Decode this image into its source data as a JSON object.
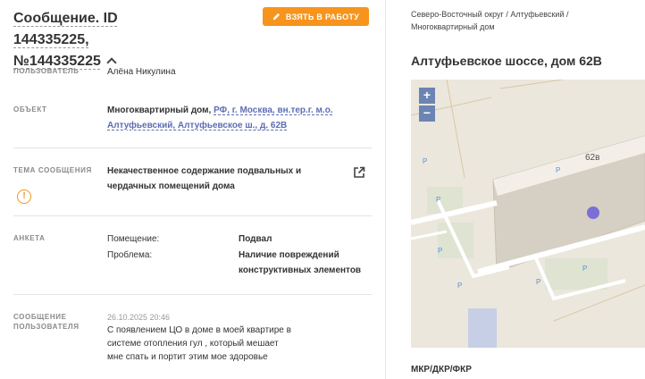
{
  "header": {
    "title_line1": "Сообщение. ID 144335225,",
    "title_line2": "№144335225",
    "take_button": "ВЗЯТЬ В РАБОТУ"
  },
  "user": {
    "label": "ПОЛЬЗОВАТЕЛЬ",
    "value": "Алёна Никулина"
  },
  "object": {
    "label": "ОБЪЕКТ",
    "type": "Многоквартирный дом,",
    "address_line1": "РФ, г. Москва, вн.тер.г. м.о.",
    "address_line2": "Алтуфьевский, Алтуфьевское ш., д. 62В"
  },
  "topic": {
    "label": "ТЕМА СООБЩЕНИЯ",
    "value_line1": "Некачественное содержание подвальных и",
    "value_line2": "чердачных помещений дома",
    "warn_symbol": "!"
  },
  "form": {
    "label": "АНКЕТА",
    "room_label": "Помещение:",
    "room_value": "Подвал",
    "problem_label": "Проблема:",
    "problem_value_line1": "Наличие повреждений",
    "problem_value_line2": "конструктивных элементов"
  },
  "message": {
    "label_line1": "СООБЩЕНИЕ",
    "label_line2": "ПОЛЬЗОВАТЕЛЯ",
    "date": "26.10.2025 20:46",
    "text_line1": "С появлением ЦО в доме в моей квартире в",
    "text_line2": "системе отопления гул , который мешает",
    "text_line3": "мне спать и портит этим мое здоровье"
  },
  "right": {
    "breadcrumb_line1": "Северо-Восточный округ / Алтуфьевский /",
    "breadcrumb_line2": "Многоквартирный дом",
    "address": "Алтуфьевское шоссе, дом 62В",
    "map_building_label": "62в",
    "zoom_in": "+",
    "zoom_out": "−",
    "parking_symbol": "P",
    "section_title": "МКР/ДКР/ФКР"
  },
  "colors": {
    "accent": "#f7941d",
    "link": "#5d6db2",
    "marker": "#7b6fd6"
  }
}
